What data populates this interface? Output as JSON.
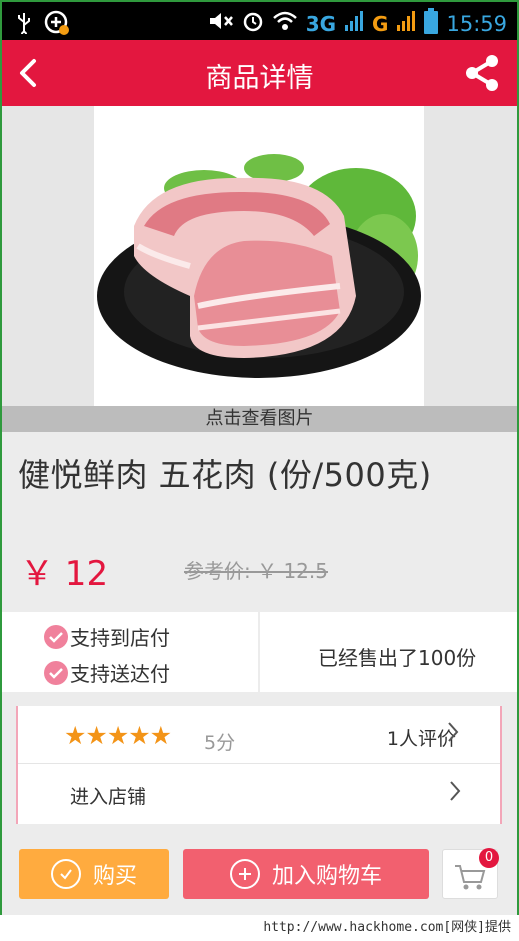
{
  "status_bar": {
    "network_3g": "3G",
    "network_g": "G",
    "time": "15:59"
  },
  "header": {
    "title": "商品详情"
  },
  "product": {
    "image_caption": "点击查看图片",
    "name": "健悦鲜肉 五花肉 (份/500克)",
    "price": "￥ 12",
    "reference_price": "参考价: ￥ 12.5"
  },
  "support": {
    "pay_at_store": "支持到店付",
    "pay_on_delivery": "支持送达付",
    "sold_text": "已经售出了100份"
  },
  "rating": {
    "stars": "★★★★★",
    "stars_value": 5,
    "score": "5分",
    "reviews": "1人评价"
  },
  "shop": {
    "label": "进入店铺"
  },
  "actions": {
    "buy_label": "购买",
    "add_cart_label": "加入购物车",
    "cart_count": "0"
  },
  "watermark": "http://www.hackhome.com[网侠]提供",
  "colors": {
    "header": "#e3173f",
    "price": "#e3173f",
    "buy_button": "#ffab3f",
    "cart_button": "#f2606f",
    "stars": "#f39418"
  }
}
